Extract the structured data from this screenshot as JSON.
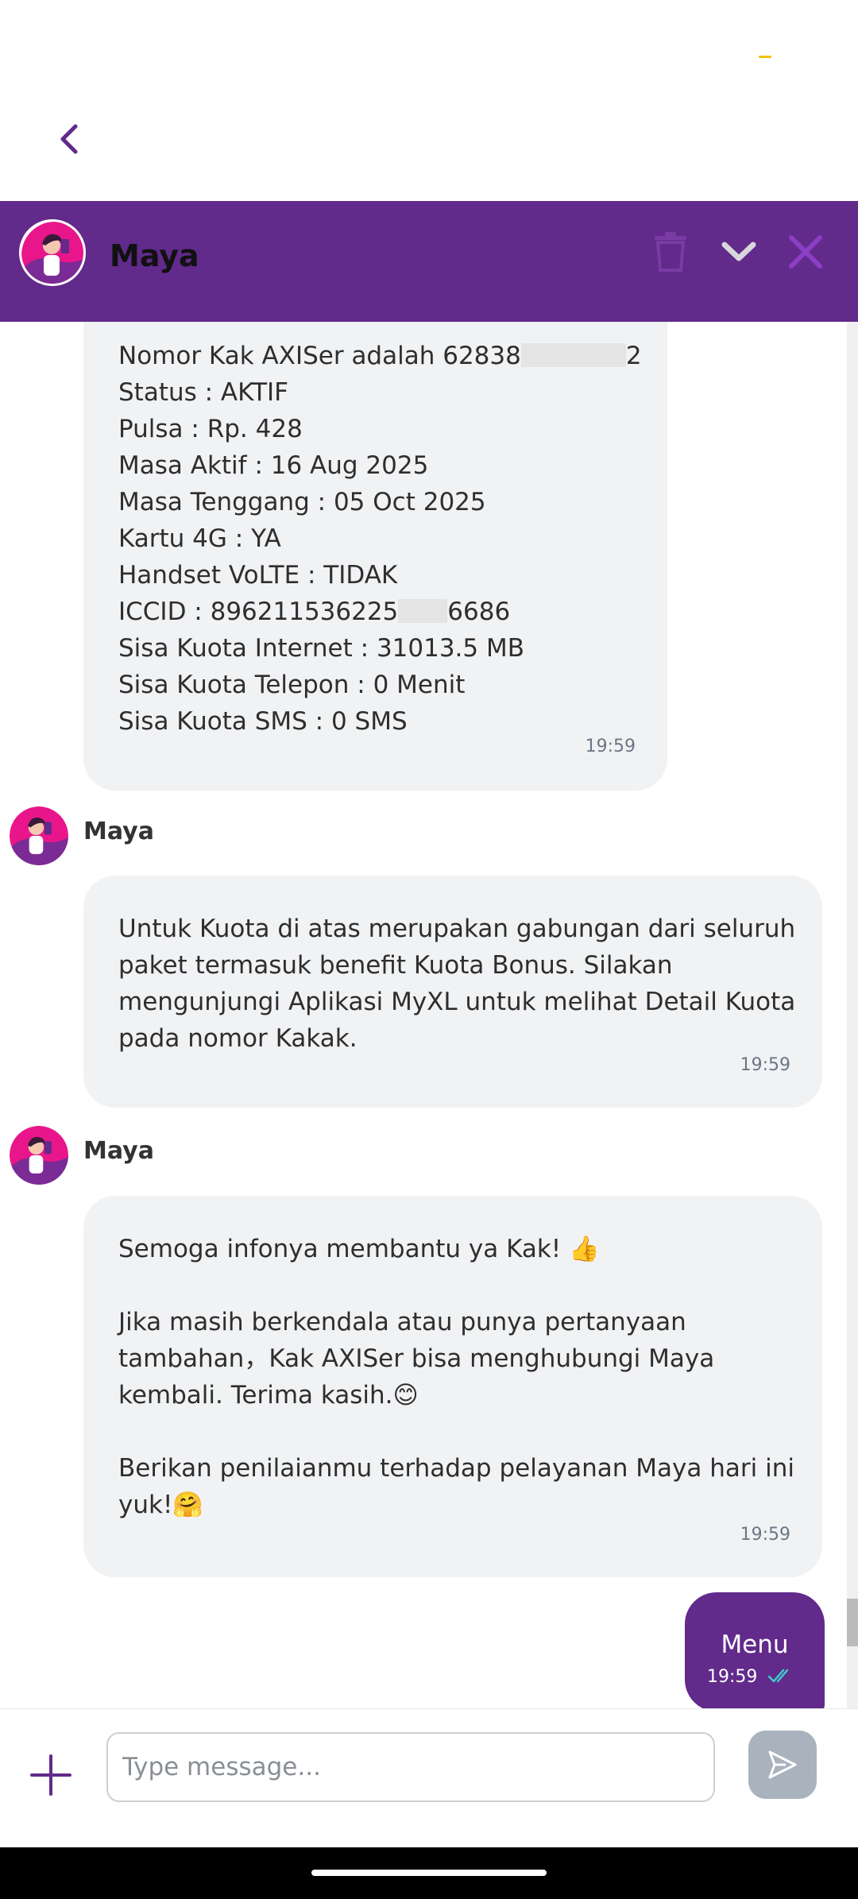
{
  "header": {
    "name": "Maya",
    "accent_color": "#612a8b",
    "icons": [
      "back-icon",
      "trash-icon",
      "chevron-down-icon",
      "close-icon"
    ]
  },
  "messages": {
    "m1": {
      "lines": [
        "Nomor Kak AXISer adalah 62838",
        "2",
        "Status : AKTIF",
        "Pulsa : Rp. 428",
        "Masa Aktif : 16 Aug 2025",
        "Masa Tenggang : 05 Oct 2025",
        "Kartu 4G : YA",
        "Handset VoLTE : TIDAK",
        "ICCID : 896211536225",
        "6686",
        "Sisa Kuota Internet : 31013.5 MB",
        "Sisa Kuota Telepon : 0 Menit",
        "Sisa Kuota SMS : 0 SMS"
      ],
      "time": "19:59"
    },
    "m2": {
      "sender": "Maya",
      "lines": [
        "Untuk Kuota di atas merupakan gabungan dari seluruh",
        "paket termasuk benefit Kuota Bonus. Silakan",
        "mengunjungi Aplikasi MyXL untuk melihat Detail Kuota",
        "pada nomor Kakak."
      ],
      "time": "19:59"
    },
    "m3": {
      "sender": "Maya",
      "lines": [
        "Semoga infonya membantu ya Kak! 👍",
        "Jika masih berkendala atau punya pertanyaan",
        "tambahan，Kak AXISer bisa menghubungi Maya",
        "kembali. Terima kasih.😊",
        "Berikan penilaianmu terhadap pelayanan Maya hari ini",
        "yuk!🤗"
      ],
      "time": "19:59"
    },
    "out": {
      "label": "Menu",
      "time": "19:59"
    }
  },
  "composer": {
    "placeholder": "Type message...",
    "value": ""
  }
}
